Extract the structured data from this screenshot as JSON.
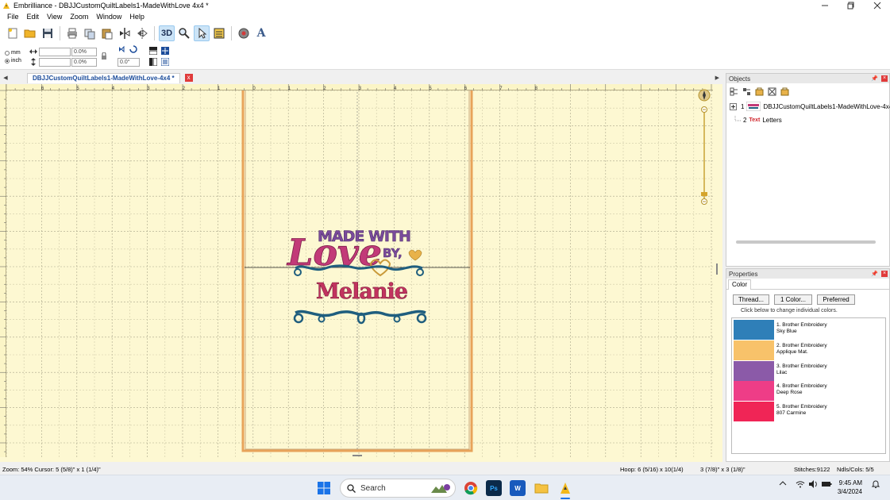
{
  "window": {
    "title": "Embrilliance - DBJJCustomQuiltLabels1-MadeWithLove 4x4 *",
    "min_icon": "minimize-icon",
    "max_icon": "maximize-icon",
    "close_icon": "close-icon"
  },
  "menu": {
    "items": [
      "File",
      "Edit",
      "View",
      "Zoom",
      "Window",
      "Help"
    ]
  },
  "toolbar": {
    "icons": [
      "new-file-icon",
      "open-folder-icon",
      "save-icon",
      "print-icon",
      "copy-icon",
      "paste-icon",
      "mirror-icon",
      "flip-icon",
      "3d-view-icon",
      "magnify-icon",
      "select-pointer-icon",
      "properties-icon",
      "stitch-simulator-icon",
      "text-tool-icon"
    ],
    "btn_3d": "3D",
    "btn_text": "A"
  },
  "units": {
    "mm_label": "mm",
    "inch_label": "inch",
    "selected": "inch"
  },
  "transform": {
    "width_percent": "0.0%",
    "height_percent": "0.0%",
    "rotation": "0.0°",
    "width_value": "",
    "height_value": ""
  },
  "document_tab": {
    "label": "DBJJCustomQuiltLabels1-MadeWithLove-4x4 *",
    "close": "x"
  },
  "design": {
    "line1": "MADE WITH",
    "line2": "Love",
    "line3": "BY,",
    "line4": "Melanie"
  },
  "objects_panel": {
    "title": "Objects",
    "item1_index": "1",
    "item1_label": "DBJJCustomQuiltLabels1-MadeWithLove-4x4",
    "item2_index": "2",
    "item2_badge": "Text",
    "item2_label": "Letters"
  },
  "properties_panel": {
    "title": "Properties",
    "tab": "Color",
    "btn_thread": "Thread...",
    "btn_color": "1 Color...",
    "btn_preferred": "Preferred",
    "note": "Click below to change individual colors.",
    "colors": [
      {
        "line1": "1. Brother Embroidery",
        "line2": "Sky Blue",
        "hex": "#2f7fb8"
      },
      {
        "line1": "2. Brother Embroidery",
        "line2": "Applique Mat.",
        "hex": "#f8c26a"
      },
      {
        "line1": "3. Brother Embroidery",
        "line2": "Lilac",
        "hex": "#8b5aa8"
      },
      {
        "line1": "4. Brother Embroidery",
        "line2": "Deep Rose",
        "hex": "#ee3d87"
      },
      {
        "line1": "5. Brother Embroidery",
        "line2": "807 Carmine",
        "hex": "#f02556"
      }
    ]
  },
  "status": {
    "zoom_cursor": "Zoom: 54%  Cursor: 5 (5/8)\" x 1 (1/4)\"",
    "hoop": "Hoop: 6 (5/16) x 10(1/4)",
    "size": "3 (7/8)\" x 3 (1/8)\"",
    "stitches": "Stitches:9122",
    "ndls": "Ndls/Cols: 5/5"
  },
  "taskbar": {
    "search_placeholder": "Search",
    "time": "9:45 AM",
    "date": "3/4/2024",
    "ps_label": "Ps",
    "word_label": "W"
  },
  "ruler_top": [
    "6",
    "5",
    "4",
    "3",
    "2",
    "1",
    "0",
    "1",
    "2",
    "3",
    "4",
    "5",
    "6",
    "7",
    "8"
  ],
  "colors": {
    "canvas_bg": "#fdf8d2",
    "hoop_border": "#e8a35a",
    "accent_blue": "#1a4b9a"
  }
}
